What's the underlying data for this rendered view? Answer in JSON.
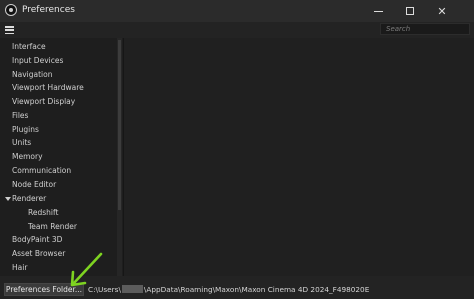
{
  "window": {
    "title": "Preferences",
    "minimize": "—",
    "maximize": "☐",
    "close": "✕"
  },
  "search": {
    "placeholder": "Search"
  },
  "sidebar": {
    "items": [
      {
        "label": "Interface"
      },
      {
        "label": "Input Devices"
      },
      {
        "label": "Navigation"
      },
      {
        "label": "Viewport Hardware"
      },
      {
        "label": "Viewport Display"
      },
      {
        "label": "Files"
      },
      {
        "label": "Plugins"
      },
      {
        "label": "Units"
      },
      {
        "label": "Memory"
      },
      {
        "label": "Communication"
      },
      {
        "label": "Node Editor"
      },
      {
        "label": "Renderer",
        "expanded": true
      },
      {
        "label": "Redshift",
        "child": true
      },
      {
        "label": "Team Render",
        "child": true
      },
      {
        "label": "BodyPaint 3D"
      },
      {
        "label": "Asset Browser"
      },
      {
        "label": "Hair"
      }
    ]
  },
  "footer": {
    "button_label": "Preferences Folder...",
    "path_prefix": "C:\\Users\\",
    "path_suffix": "\\AppData\\Roaming\\Maxon\\Maxon Cinema 4D 2024_F498020E"
  },
  "colors": {
    "annotation_arrow": "#7ed321",
    "background": "#1e1e1e",
    "titlebar": "#2b2b2b"
  }
}
